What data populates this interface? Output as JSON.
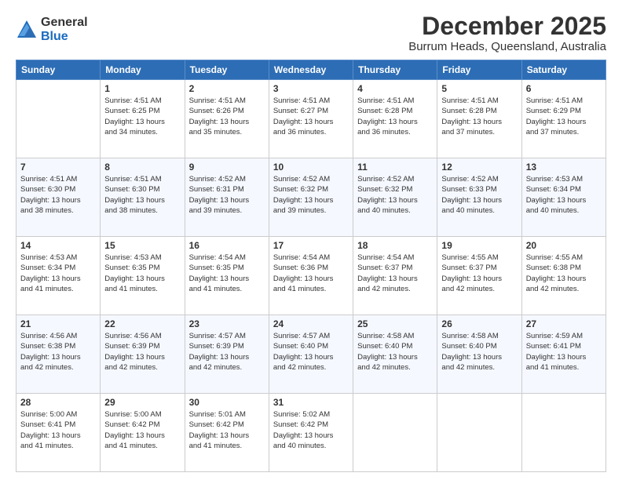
{
  "logo": {
    "general": "General",
    "blue": "Blue"
  },
  "title": "December 2025",
  "location": "Burrum Heads, Queensland, Australia",
  "days_header": [
    "Sunday",
    "Monday",
    "Tuesday",
    "Wednesday",
    "Thursday",
    "Friday",
    "Saturday"
  ],
  "weeks": [
    [
      {
        "day": "",
        "info": ""
      },
      {
        "day": "1",
        "info": "Sunrise: 4:51 AM\nSunset: 6:25 PM\nDaylight: 13 hours\nand 34 minutes."
      },
      {
        "day": "2",
        "info": "Sunrise: 4:51 AM\nSunset: 6:26 PM\nDaylight: 13 hours\nand 35 minutes."
      },
      {
        "day": "3",
        "info": "Sunrise: 4:51 AM\nSunset: 6:27 PM\nDaylight: 13 hours\nand 36 minutes."
      },
      {
        "day": "4",
        "info": "Sunrise: 4:51 AM\nSunset: 6:28 PM\nDaylight: 13 hours\nand 36 minutes."
      },
      {
        "day": "5",
        "info": "Sunrise: 4:51 AM\nSunset: 6:28 PM\nDaylight: 13 hours\nand 37 minutes."
      },
      {
        "day": "6",
        "info": "Sunrise: 4:51 AM\nSunset: 6:29 PM\nDaylight: 13 hours\nand 37 minutes."
      }
    ],
    [
      {
        "day": "7",
        "info": "Sunrise: 4:51 AM\nSunset: 6:30 PM\nDaylight: 13 hours\nand 38 minutes."
      },
      {
        "day": "8",
        "info": "Sunrise: 4:51 AM\nSunset: 6:30 PM\nDaylight: 13 hours\nand 38 minutes."
      },
      {
        "day": "9",
        "info": "Sunrise: 4:52 AM\nSunset: 6:31 PM\nDaylight: 13 hours\nand 39 minutes."
      },
      {
        "day": "10",
        "info": "Sunrise: 4:52 AM\nSunset: 6:32 PM\nDaylight: 13 hours\nand 39 minutes."
      },
      {
        "day": "11",
        "info": "Sunrise: 4:52 AM\nSunset: 6:32 PM\nDaylight: 13 hours\nand 40 minutes."
      },
      {
        "day": "12",
        "info": "Sunrise: 4:52 AM\nSunset: 6:33 PM\nDaylight: 13 hours\nand 40 minutes."
      },
      {
        "day": "13",
        "info": "Sunrise: 4:53 AM\nSunset: 6:34 PM\nDaylight: 13 hours\nand 40 minutes."
      }
    ],
    [
      {
        "day": "14",
        "info": "Sunrise: 4:53 AM\nSunset: 6:34 PM\nDaylight: 13 hours\nand 41 minutes."
      },
      {
        "day": "15",
        "info": "Sunrise: 4:53 AM\nSunset: 6:35 PM\nDaylight: 13 hours\nand 41 minutes."
      },
      {
        "day": "16",
        "info": "Sunrise: 4:54 AM\nSunset: 6:35 PM\nDaylight: 13 hours\nand 41 minutes."
      },
      {
        "day": "17",
        "info": "Sunrise: 4:54 AM\nSunset: 6:36 PM\nDaylight: 13 hours\nand 41 minutes."
      },
      {
        "day": "18",
        "info": "Sunrise: 4:54 AM\nSunset: 6:37 PM\nDaylight: 13 hours\nand 42 minutes."
      },
      {
        "day": "19",
        "info": "Sunrise: 4:55 AM\nSunset: 6:37 PM\nDaylight: 13 hours\nand 42 minutes."
      },
      {
        "day": "20",
        "info": "Sunrise: 4:55 AM\nSunset: 6:38 PM\nDaylight: 13 hours\nand 42 minutes."
      }
    ],
    [
      {
        "day": "21",
        "info": "Sunrise: 4:56 AM\nSunset: 6:38 PM\nDaylight: 13 hours\nand 42 minutes."
      },
      {
        "day": "22",
        "info": "Sunrise: 4:56 AM\nSunset: 6:39 PM\nDaylight: 13 hours\nand 42 minutes."
      },
      {
        "day": "23",
        "info": "Sunrise: 4:57 AM\nSunset: 6:39 PM\nDaylight: 13 hours\nand 42 minutes."
      },
      {
        "day": "24",
        "info": "Sunrise: 4:57 AM\nSunset: 6:40 PM\nDaylight: 13 hours\nand 42 minutes."
      },
      {
        "day": "25",
        "info": "Sunrise: 4:58 AM\nSunset: 6:40 PM\nDaylight: 13 hours\nand 42 minutes."
      },
      {
        "day": "26",
        "info": "Sunrise: 4:58 AM\nSunset: 6:40 PM\nDaylight: 13 hours\nand 42 minutes."
      },
      {
        "day": "27",
        "info": "Sunrise: 4:59 AM\nSunset: 6:41 PM\nDaylight: 13 hours\nand 41 minutes."
      }
    ],
    [
      {
        "day": "28",
        "info": "Sunrise: 5:00 AM\nSunset: 6:41 PM\nDaylight: 13 hours\nand 41 minutes."
      },
      {
        "day": "29",
        "info": "Sunrise: 5:00 AM\nSunset: 6:42 PM\nDaylight: 13 hours\nand 41 minutes."
      },
      {
        "day": "30",
        "info": "Sunrise: 5:01 AM\nSunset: 6:42 PM\nDaylight: 13 hours\nand 41 minutes."
      },
      {
        "day": "31",
        "info": "Sunrise: 5:02 AM\nSunset: 6:42 PM\nDaylight: 13 hours\nand 40 minutes."
      },
      {
        "day": "",
        "info": ""
      },
      {
        "day": "",
        "info": ""
      },
      {
        "day": "",
        "info": ""
      }
    ]
  ]
}
